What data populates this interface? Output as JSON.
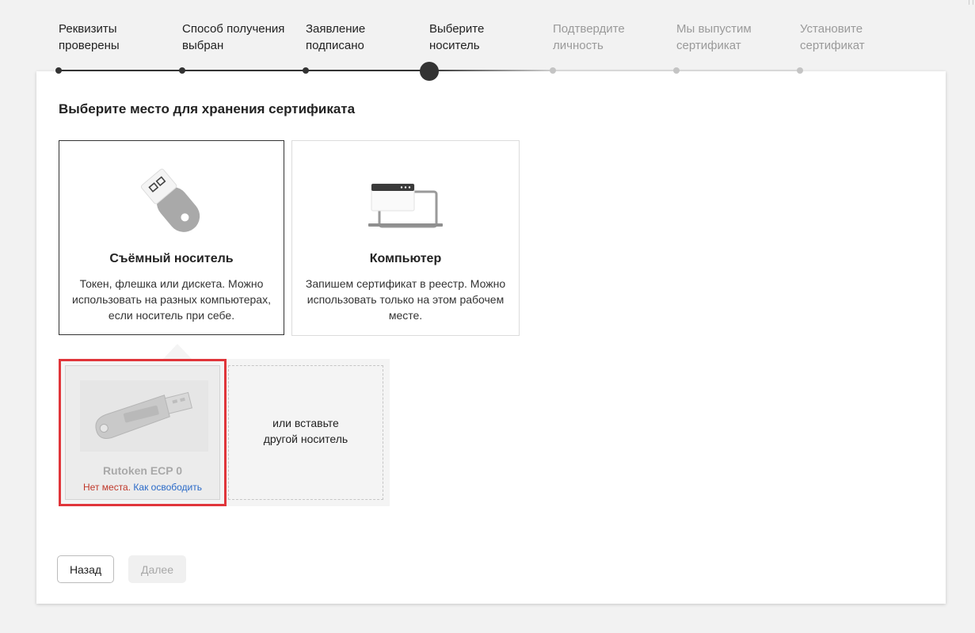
{
  "steps": [
    {
      "label": "Реквизиты\nпроверены",
      "state": "done"
    },
    {
      "label": "Способ получения\nвыбран",
      "state": "done"
    },
    {
      "label": "Заявление\nподписано",
      "state": "done"
    },
    {
      "label": "Выберите\nноситель",
      "state": "current"
    },
    {
      "label": "Подтвердите\nличность",
      "state": "future"
    },
    {
      "label": "Мы выпустим\nсертификат",
      "state": "future"
    },
    {
      "label": "Установите\nсертификат",
      "state": "future"
    }
  ],
  "main": {
    "title": "Выберите место для хранения сертификата",
    "options": [
      {
        "title": "Съёмный носитель",
        "description": "Токен, флешка или дискета. Можно использовать на разных компьютерах, если носитель при себе.",
        "icon": "usb-flash-icon",
        "selected": true
      },
      {
        "title": "Компьютер",
        "description": "Запишем сертификат в реестр. Можно использовать только на этом рабочем месте.",
        "icon": "laptop-icon",
        "selected": false
      }
    ],
    "media": {
      "token_name": "Rutoken ECP 0",
      "status_text": "Нет места.",
      "status_link": "Как освободить",
      "token_icon": "rutoken-icon",
      "insert_text": "или вставьте\nдругой носитель"
    }
  },
  "buttons": {
    "back": "Назад",
    "next": "Далее"
  },
  "colors": {
    "accent_dark": "#333333",
    "highlight_border": "#e0353a",
    "error_text": "#c0392b",
    "link": "#2a6ac8"
  }
}
